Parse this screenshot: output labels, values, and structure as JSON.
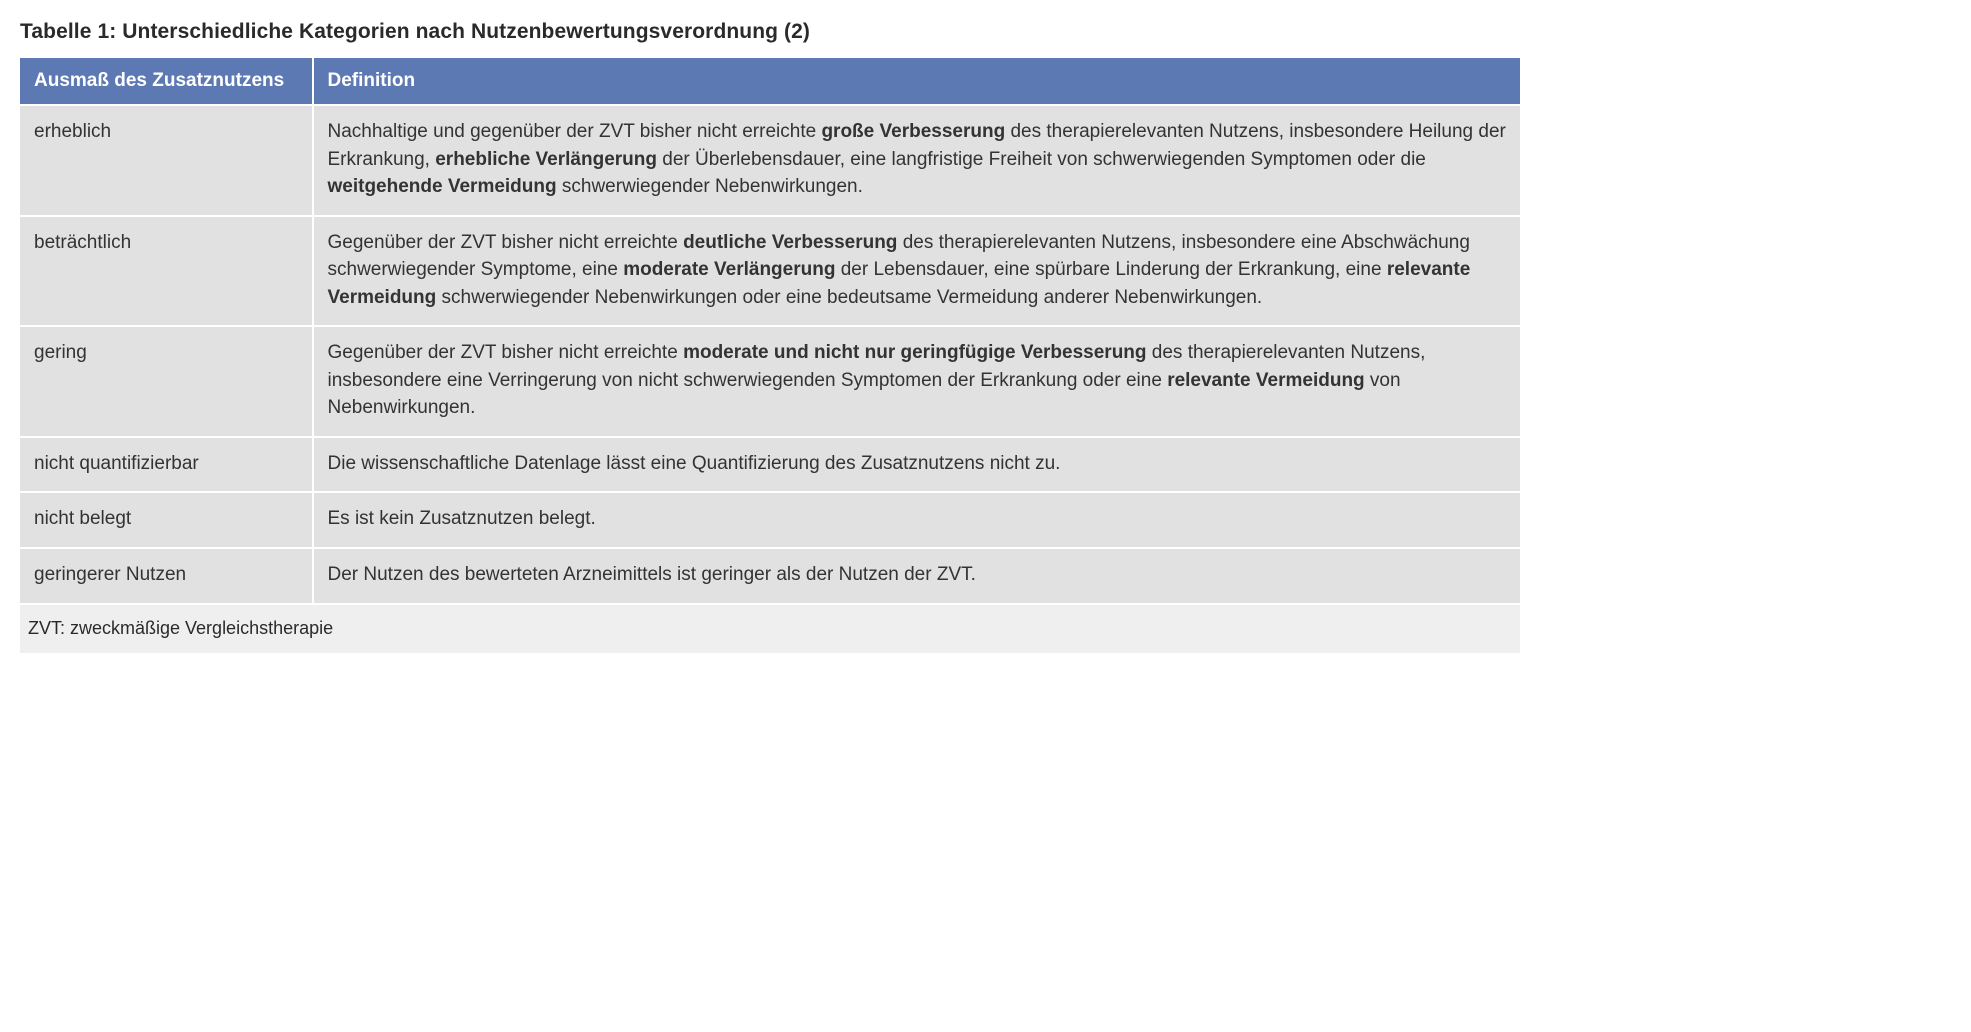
{
  "caption": "Tabelle 1: Unterschiedliche Kategorien nach Nutzenbewertungsverordnung (2)",
  "headers": {
    "col1": "Ausmaß des Zusatznutzens",
    "col2": "Definition"
  },
  "rows": [
    {
      "cat": "erheblich",
      "def_html": "Nachhaltige und gegenüber der ZVT bisher nicht erreichte <b>große Verbesserung</b> des therapierelevanten Nutzens, insbesondere Heilung der Erkrankung, <b>erhebliche Verlängerung</b> der Überlebensdauer, eine langfristige Freiheit von schwerwiegenden Symptomen oder die <b>weitgehende Vermeidung</b> schwerwiegender Nebenwirkungen."
    },
    {
      "cat": "beträchtlich",
      "def_html": "Gegenüber der ZVT bisher nicht erreichte <b>deutliche Verbesserung</b> des therapierelevanten Nutzens, insbesondere eine Abschwächung schwerwiegender Symptome, eine <b>moderate Verlängerung</b> der Lebensdauer, eine spürbare Linderung der Erkrankung, eine <b>relevante Vermeidung</b> schwerwiegender Nebenwirkungen oder eine bedeutsame Vermeidung anderer Nebenwirkungen."
    },
    {
      "cat": "gering",
      "def_html": "Gegenüber der ZVT bisher nicht erreichte <b>moderate und nicht nur geringfügige Verbesserung</b> des therapierelevanten Nutzens, insbesondere eine Verringerung von nicht schwerwiegenden Symptomen der Erkrankung oder eine <b>relevante Vermeidung</b> von Nebenwirkungen."
    },
    {
      "cat": "nicht quantifizierbar",
      "def_html": "Die wissenschaftliche Datenlage lässt eine Quantifizierung des Zusatznutzens nicht zu."
    },
    {
      "cat": "nicht belegt",
      "def_html": "Es ist kein Zusatznutzen belegt."
    },
    {
      "cat": "geringerer Nutzen",
      "def_html": "Der Nutzen des bewerteten Arzneimittels ist geringer als der Nutzen der ZVT."
    }
  ],
  "footnote": "ZVT: zweckmäßige Vergleichstherapie"
}
